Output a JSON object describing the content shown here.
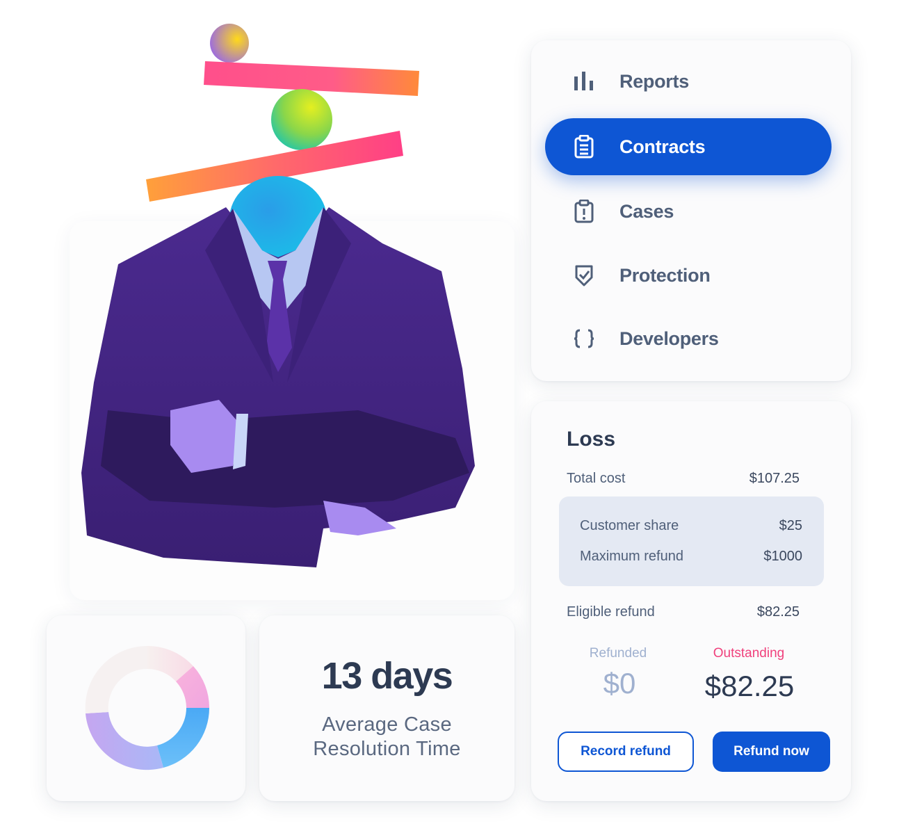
{
  "nav": {
    "items": [
      {
        "label": "Reports",
        "icon": "bar-chart-icon",
        "active": false
      },
      {
        "label": "Contracts",
        "icon": "clipboard-icon",
        "active": true
      },
      {
        "label": "Cases",
        "icon": "alert-clipboard-icon",
        "active": false
      },
      {
        "label": "Protection",
        "icon": "shield-check-icon",
        "active": false
      },
      {
        "label": "Developers",
        "icon": "code-braces-icon",
        "active": false
      }
    ]
  },
  "stat": {
    "value": "13 days",
    "label": "Average Case Resolution Time"
  },
  "loss": {
    "title": "Loss",
    "total_cost_label": "Total cost",
    "total_cost_value": "$107.25",
    "customer_share_label": "Customer share",
    "customer_share_value": "$25",
    "max_refund_label": "Maximum refund",
    "max_refund_value": "$1000",
    "eligible_refund_label": "Eligible refund",
    "eligible_refund_value": "$82.25",
    "refunded_label": "Refunded",
    "refunded_value": "$0",
    "outstanding_label": "Outstanding",
    "outstanding_value": "$82.25",
    "record_refund_button": "Record refund",
    "refund_now_button": "Refund now"
  },
  "colors": {
    "accent": "#0e56d4",
    "outstanding": "#f0407c",
    "refunded": "#9fb0cf",
    "suit": "#4a2a8c"
  }
}
